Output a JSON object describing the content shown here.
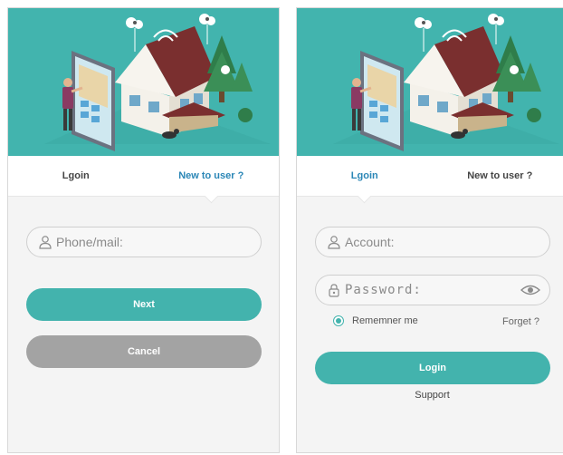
{
  "colors": {
    "accent": "#43b3ad",
    "hero_background": "#42b4ae",
    "tab_active": "#2a86b6",
    "button_disabled": "#a3a3a3"
  },
  "register_screen": {
    "tabs": [
      {
        "label": "Lgoin",
        "active": false
      },
      {
        "label": "New to user ?",
        "active": true
      }
    ],
    "phone_field": {
      "placeholder": "Phone/mail:",
      "value": "",
      "icon": "user-icon"
    },
    "next_button": "Next",
    "cancel_button": "Cancel"
  },
  "login_screen": {
    "tabs": [
      {
        "label": "Lgoin",
        "active": true
      },
      {
        "label": "New to user ?",
        "active": false
      }
    ],
    "account_field": {
      "placeholder": "Account:",
      "value": "",
      "icon": "user-icon"
    },
    "password_field": {
      "placeholder": "Password:",
      "value": "",
      "icon": "lock-icon",
      "toggle_icon": "eye-icon"
    },
    "remember": {
      "label": "Rememner me",
      "checked": true
    },
    "forget_link": "Forget ?",
    "login_button": "Login",
    "support_link": "Support"
  }
}
